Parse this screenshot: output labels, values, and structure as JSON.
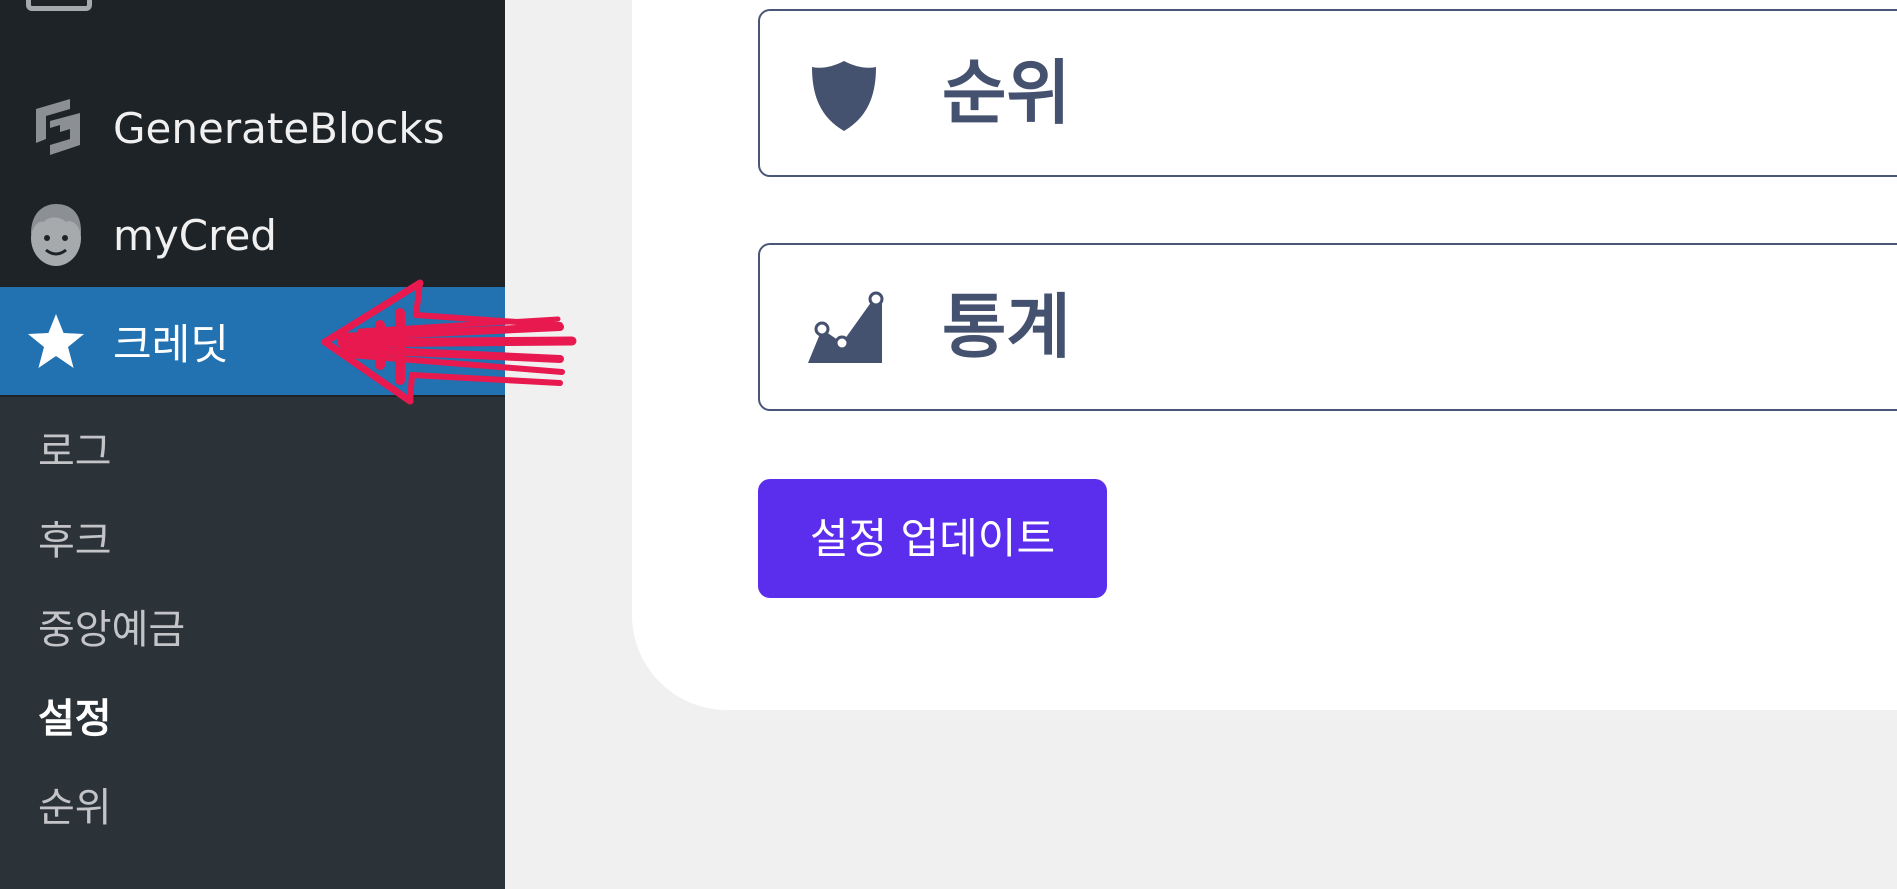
{
  "sidebar": {
    "menu": [
      {
        "label": "GenerateBlocks",
        "icon": "generateblocks-logo-icon"
      },
      {
        "label": "myCred",
        "icon": "mycred-face-icon"
      },
      {
        "label": "크레딧",
        "icon": "star-icon",
        "active": true
      }
    ],
    "submenu": [
      {
        "label": "로그"
      },
      {
        "label": "후크"
      },
      {
        "label": "중앙예금"
      },
      {
        "label": "설정",
        "current": true
      },
      {
        "label": "순위"
      }
    ],
    "active_color": "#2271b1",
    "annotation": "red-arrow-pointing-left"
  },
  "main": {
    "sections": [
      {
        "title": "순위",
        "icon": "shield-icon"
      },
      {
        "title": "통계",
        "icon": "chart-area-icon"
      }
    ],
    "update_button": {
      "label": "설정 업데이트",
      "color": "#5b2ded"
    }
  }
}
